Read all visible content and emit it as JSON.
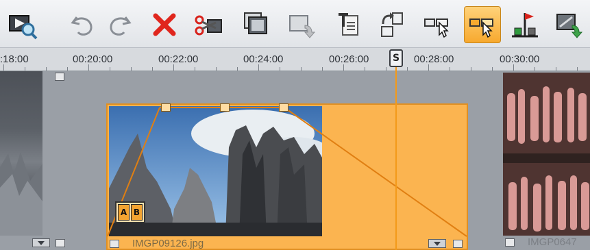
{
  "toolbar": {
    "buttons": [
      {
        "name": "scene-detect-button",
        "icon": "film-search-icon",
        "active": false
      },
      {
        "name": "undo-button",
        "icon": "undo-icon",
        "active": false
      },
      {
        "name": "redo-button",
        "icon": "redo-icon",
        "active": false
      },
      {
        "name": "delete-button",
        "icon": "delete-x-icon",
        "active": false
      },
      {
        "name": "split-clip-button",
        "icon": "scissors-icon",
        "active": false
      },
      {
        "name": "copy-clip-button",
        "icon": "stacked-frames-icon",
        "active": false
      },
      {
        "name": "clip-properties-button",
        "icon": "clip-arrow-icon",
        "active": false
      },
      {
        "name": "title-button",
        "icon": "text-document-icon",
        "active": false
      },
      {
        "name": "snapshot-button",
        "icon": "frame-rotate-icon",
        "active": false
      },
      {
        "name": "move-left-mode-button",
        "icon": "clip-cursor-icon",
        "active": false
      },
      {
        "name": "move-right-mode-button",
        "icon": "clip-cursor-icon",
        "active": true
      },
      {
        "name": "marker-button",
        "icon": "flag-marker-icon",
        "active": false
      },
      {
        "name": "export-button",
        "icon": "frame-green-arrow-icon",
        "active": false
      }
    ]
  },
  "ruler": {
    "labels": [
      ":18:00",
      "00:20:00",
      "00:22:00",
      "00:24:00",
      "00:26:00",
      "00:28:00",
      "00:30:00"
    ],
    "playhead_label": "S"
  },
  "clips": {
    "left": {
      "name": ""
    },
    "selected": {
      "name": "IMGP09126.jpg",
      "transition_a": "A",
      "transition_b": "B"
    },
    "right": {
      "name": "IMGP0647"
    }
  },
  "colors": {
    "selection": "#fbb450",
    "playhead": "#f39a1a",
    "track_bg": "#9a9fa6"
  }
}
